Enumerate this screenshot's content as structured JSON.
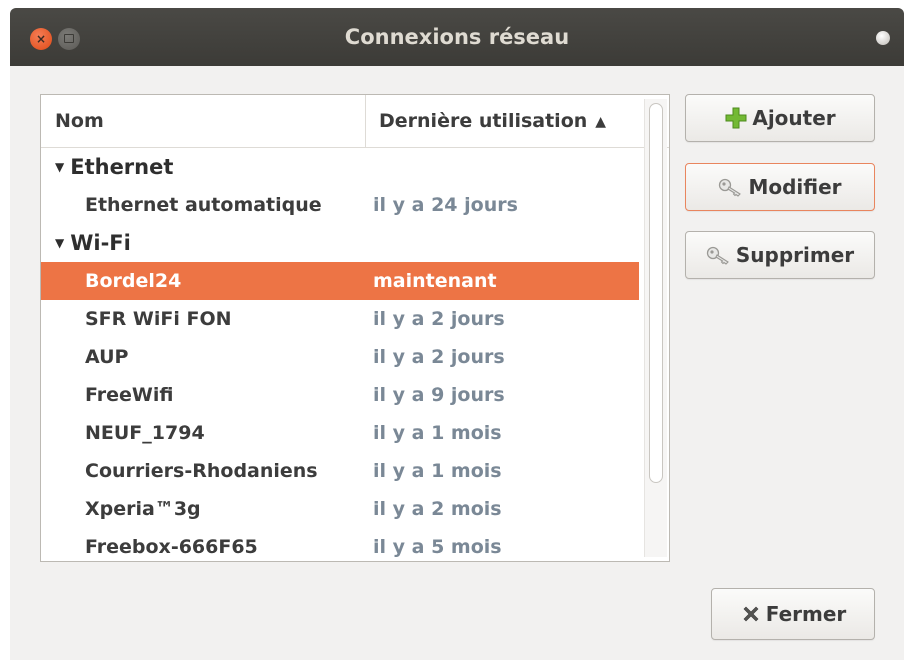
{
  "window": {
    "title": "Connexions réseau",
    "close_symbol": "×"
  },
  "list": {
    "columns": {
      "name": "Nom",
      "last_used": "Dernière utilisation"
    },
    "sort_icon": "sort-ascending-icon",
    "groups": [
      {
        "label": "Ethernet",
        "items": [
          {
            "name": "Ethernet automatique",
            "last_used": "il y a 24 jours"
          }
        ]
      },
      {
        "label": "Wi-Fi",
        "items": [
          {
            "name": "Bordel24",
            "last_used": "maintenant",
            "selected": true
          },
          {
            "name": "SFR WiFi FON",
            "last_used": "il y a 2 jours"
          },
          {
            "name": "AUP",
            "last_used": "il y a 2 jours"
          },
          {
            "name": "FreeWifi",
            "last_used": "il y a 9 jours"
          },
          {
            "name": "NEUF_1794",
            "last_used": "il y a 1 mois"
          },
          {
            "name": "Courriers-Rhodaniens",
            "last_used": "il y a 1 mois"
          },
          {
            "name": "Xperia™3g",
            "last_used": "il y a 2 mois"
          },
          {
            "name": "Freebox-666F65",
            "last_used": "il y a 5 mois"
          }
        ]
      }
    ]
  },
  "buttons": {
    "add": "Ajouter",
    "edit": "Modifier",
    "delete": "Supprimer",
    "close": "Fermer"
  },
  "colors": {
    "selection": "#ed7445",
    "titlebar": "#3c3b37",
    "add_icon": "#6fb52c"
  }
}
